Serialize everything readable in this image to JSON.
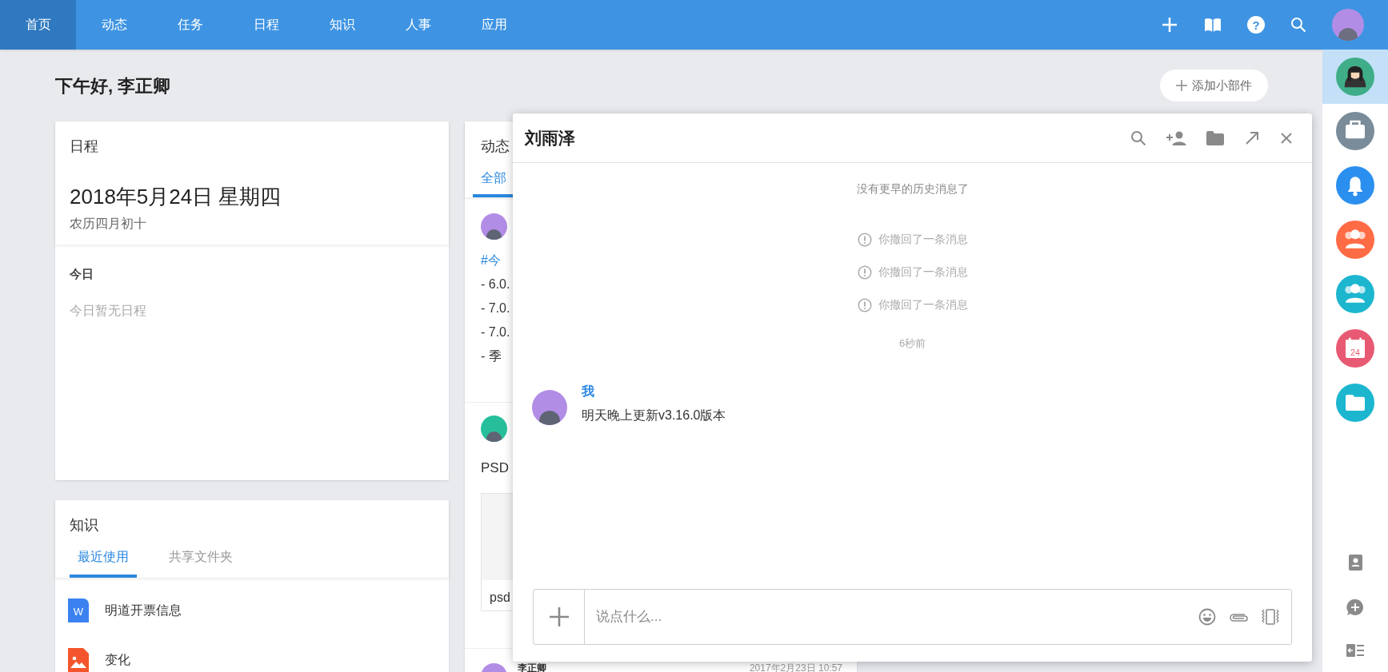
{
  "nav": {
    "help_icon": "?",
    "tabs": [
      {
        "label": "首页",
        "selected": true
      },
      {
        "label": "动态",
        "selected": false
      },
      {
        "label": "任务",
        "selected": false
      },
      {
        "label": "日程",
        "selected": false
      },
      {
        "label": "知识",
        "selected": false
      },
      {
        "label": "人事",
        "selected": false
      },
      {
        "label": "应用",
        "selected": false
      }
    ]
  },
  "greeting": "下午好, 李正卿",
  "add_widget_button": "添加小部件",
  "schedule_card": {
    "title": "日程",
    "date": "2018年5月24日 星期四",
    "lunar": "农历四月初十",
    "section": "今日",
    "empty_text": "今日暂无日程"
  },
  "knowledge_card": {
    "title": "知识",
    "tabs": [
      {
        "label": "最近使用",
        "selected": true
      },
      {
        "label": "共享文件夹",
        "selected": false
      }
    ],
    "items": [
      {
        "kind": "word",
        "icon_letter": "W",
        "name": "明道开票信息"
      },
      {
        "kind": "image",
        "name": "变化"
      }
    ]
  },
  "feed_card": {
    "title": "动态",
    "tabs": [
      {
        "label": "全部",
        "selected": true
      }
    ],
    "posts": [
      {
        "tag": "#今",
        "lines": [
          "- 6.0.",
          "- 7.0.",
          "- 7.0.",
          "- 季"
        ]
      },
      {
        "text": "PSD",
        "attachment": "psd"
      },
      {
        "author": "李正卿",
        "time": "2017年2月23日 10:57"
      }
    ]
  },
  "chat": {
    "title": "刘雨泽",
    "notice": "没有更早的历史消息了",
    "events": [
      {
        "kind": "recall",
        "text": "你撤回了一条消息"
      },
      {
        "kind": "recall",
        "text": "你撤回了一条消息"
      },
      {
        "kind": "recall",
        "text": "你撤回了一条消息"
      },
      {
        "kind": "time",
        "text": "6秒前"
      }
    ],
    "messages": [
      {
        "sender": "我",
        "text": "明天晚上更新v3.16.0版本"
      }
    ],
    "input": {
      "placeholder": "说点什么..."
    }
  },
  "sidebar": {
    "items": [
      {
        "kind": "contact",
        "selected": true
      },
      {
        "kind": "briefcase",
        "selected": false
      },
      {
        "kind": "bell",
        "selected": false
      },
      {
        "kind": "group",
        "selected": false
      },
      {
        "kind": "team",
        "selected": false
      },
      {
        "kind": "calendar",
        "label": "24",
        "selected": false
      },
      {
        "kind": "folder",
        "selected": false
      }
    ]
  }
}
